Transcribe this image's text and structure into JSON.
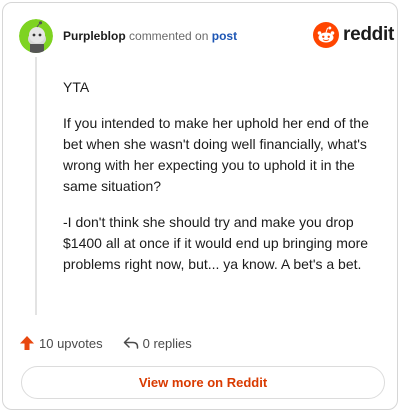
{
  "header": {
    "username": "Purpleblop",
    "commented_text": "commented on",
    "post_link": "post",
    "brand": "reddit"
  },
  "comment": {
    "paragraphs": [
      "YTA",
      "If you intended to make her uphold her end of the bet when she wasn't doing well financially, what's wrong with her expecting you to uphold it in the same situation?",
      "-I don't think she should try and make you drop $1400 all at once if it would end up bringing more problems right now, but... ya know. A bet's a bet."
    ]
  },
  "actions": {
    "upvotes": "10 upvotes",
    "replies": "0 replies"
  },
  "footer": {
    "view_more": "View more on Reddit"
  },
  "colors": {
    "upvote": "#e8470f",
    "brand": "#ff4500",
    "link": "#1c55b4",
    "view_more": "#d93a00",
    "avatar_bg": "#7ed321"
  }
}
